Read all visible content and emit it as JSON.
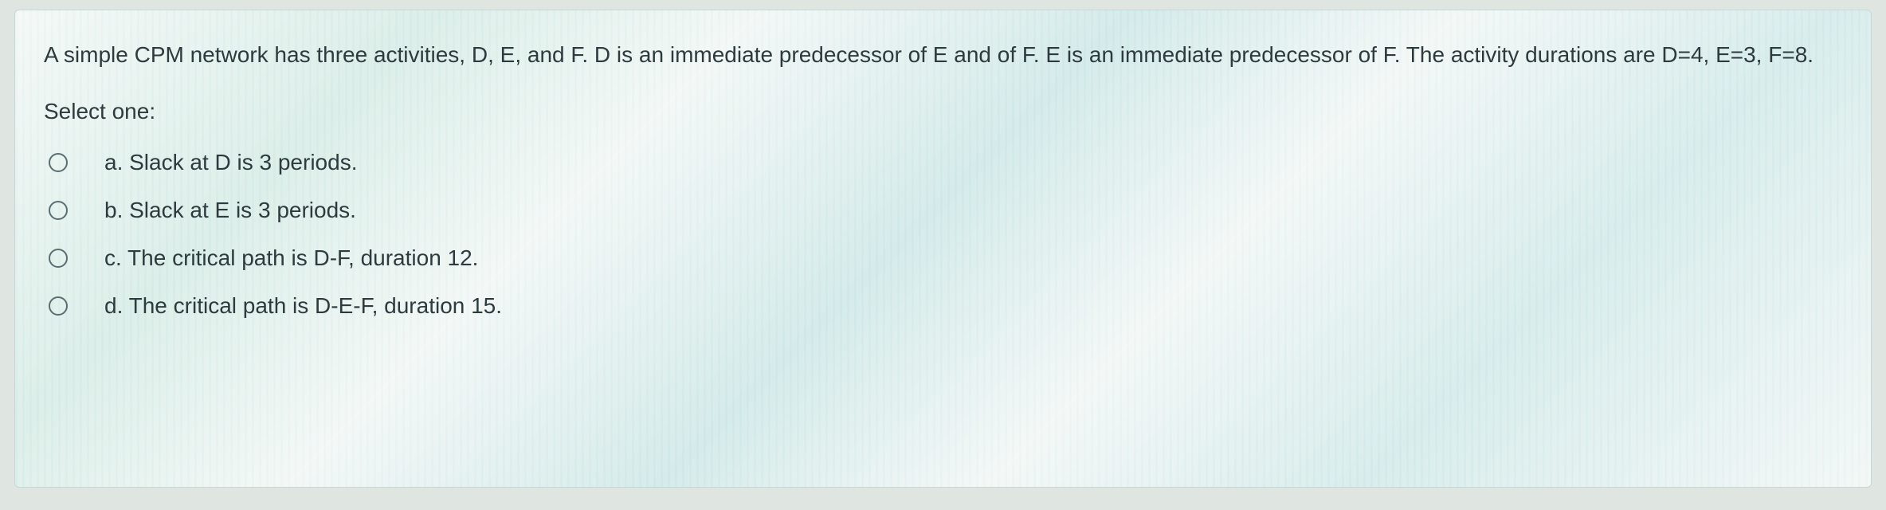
{
  "question": {
    "stem": "A simple CPM network has three activities, D, E, and F. D is an immediate predecessor of E and of F. E is an immediate predecessor of F. The activity durations are D=4, E=3, F=8.",
    "select_label": "Select one:",
    "options": [
      {
        "key": "a",
        "text": "a. Slack at D is 3 periods."
      },
      {
        "key": "b",
        "text": "b. Slack at E is 3 periods."
      },
      {
        "key": "c",
        "text": "c. The critical path is D-F, duration 12."
      },
      {
        "key": "d",
        "text": "d. The critical path is D-E-F, duration 15."
      }
    ]
  }
}
